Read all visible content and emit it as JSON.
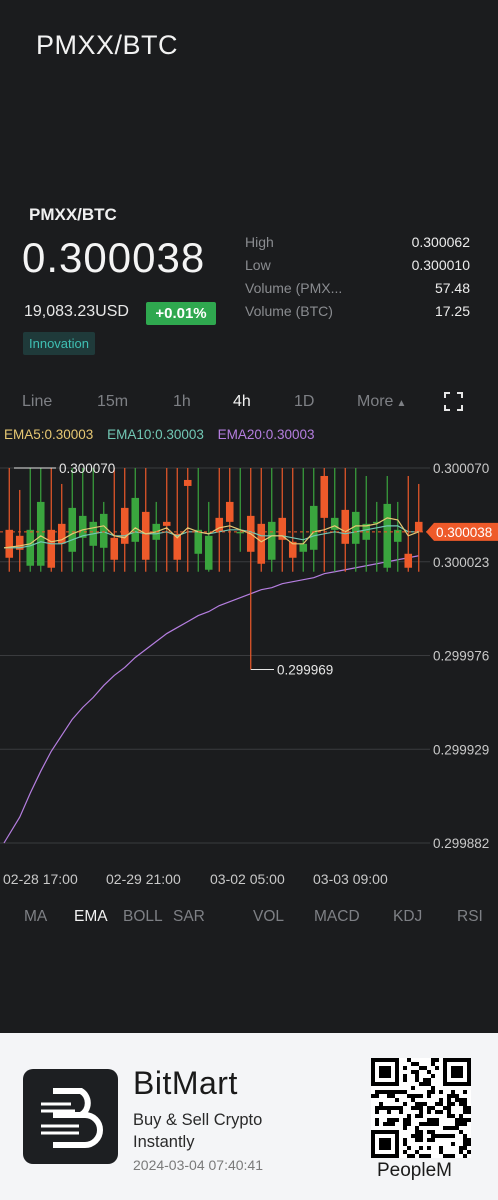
{
  "app": {
    "title": "PMXX/BTC"
  },
  "ticker": {
    "pair": "PMXX/BTC",
    "last_price": "0.300038",
    "usd_value": "19,083.23USD",
    "change": "+0.01%",
    "tag": "Innovation",
    "stats": [
      {
        "label": "High",
        "value": "0.300062"
      },
      {
        "label": "Low",
        "value": "0.300010"
      },
      {
        "label": "Volume (PMX...",
        "value": "57.48"
      },
      {
        "label": "Volume (BTC)",
        "value": "17.25"
      }
    ]
  },
  "timeframes": {
    "items": [
      "Line",
      "15m",
      "1h",
      "4h",
      "1D",
      "More"
    ],
    "active": "4h"
  },
  "ema_legend": {
    "ema5": "EMA5:0.30003",
    "ema10": "EMA10:0.30003",
    "ema20": "EMA20:0.30003"
  },
  "colors": {
    "up": "#3aa53e",
    "down": "#ee5a2a",
    "ema5": "#e7c873",
    "ema10": "#72c8b5",
    "ema20": "#b57ee0",
    "grid": "#3a3b3e",
    "badge_up": "#2fa84f"
  },
  "chart_data": {
    "type": "candlestick",
    "y_ticks": [
      "0.300070",
      "0.300023",
      "0.299976",
      "0.299929",
      "0.299882"
    ],
    "x_ticks": [
      "02-28 17:00",
      "02-29 21:00",
      "03-02 05:00",
      "03-03 09:00"
    ],
    "ylim": [
      0.299882,
      0.30007
    ],
    "last_price_label": "0.300038",
    "high_marker": "0.300070",
    "low_marker": "0.299969",
    "candles": [
      {
        "open": 0.300039,
        "close": 0.300025,
        "high": 0.30007,
        "low": 0.300018
      },
      {
        "open": 0.300036,
        "close": 0.300029,
        "high": 0.300059,
        "low": 0.300018
      },
      {
        "open": 0.300021,
        "close": 0.300039,
        "high": 0.30007,
        "low": 0.300018
      },
      {
        "open": 0.300021,
        "close": 0.300053,
        "high": 0.30007,
        "low": 0.300018
      },
      {
        "open": 0.300039,
        "close": 0.30002,
        "high": 0.30007,
        "low": 0.300018
      },
      {
        "open": 0.300042,
        "close": 0.300032,
        "high": 0.300062,
        "low": 0.300018
      },
      {
        "open": 0.300028,
        "close": 0.30005,
        "high": 0.30007,
        "low": 0.300018
      },
      {
        "open": 0.300035,
        "close": 0.300046,
        "high": 0.30007,
        "low": 0.300018
      },
      {
        "open": 0.300031,
        "close": 0.300043,
        "high": 0.30007,
        "low": 0.300018
      },
      {
        "open": 0.30003,
        "close": 0.300047,
        "high": 0.300053,
        "low": 0.300018
      },
      {
        "open": 0.300035,
        "close": 0.300024,
        "high": 0.30007,
        "low": 0.300018
      },
      {
        "open": 0.30005,
        "close": 0.300032,
        "high": 0.30007,
        "low": 0.300018
      },
      {
        "open": 0.300033,
        "close": 0.300055,
        "high": 0.30007,
        "low": 0.300018
      },
      {
        "open": 0.300048,
        "close": 0.300024,
        "high": 0.30007,
        "low": 0.300018
      },
      {
        "open": 0.300034,
        "close": 0.300042,
        "high": 0.300053,
        "low": 0.300018
      },
      {
        "open": 0.300043,
        "close": 0.300041,
        "high": 0.30007,
        "low": 0.300018
      },
      {
        "open": 0.300037,
        "close": 0.300024,
        "high": 0.30007,
        "low": 0.300018
      },
      {
        "open": 0.300064,
        "close": 0.300061,
        "high": 0.30007,
        "low": 0.300018
      },
      {
        "open": 0.300027,
        "close": 0.300039,
        "high": 0.30007,
        "low": 0.300018
      },
      {
        "open": 0.300019,
        "close": 0.300036,
        "high": 0.300053,
        "low": 0.300018
      },
      {
        "open": 0.300045,
        "close": 0.300038,
        "high": 0.30007,
        "low": 0.300018
      },
      {
        "open": 0.300053,
        "close": 0.300043,
        "high": 0.30007,
        "low": 0.300018
      },
      {
        "open": 0.300038,
        "close": 0.300038,
        "high": 0.30007,
        "low": 0.300028
      },
      {
        "open": 0.300046,
        "close": 0.300028,
        "high": 0.30007,
        "low": 0.299969
      },
      {
        "open": 0.300042,
        "close": 0.300022,
        "high": 0.30007,
        "low": 0.300018
      },
      {
        "open": 0.300024,
        "close": 0.300043,
        "high": 0.30007,
        "low": 0.300018
      },
      {
        "open": 0.300045,
        "close": 0.300034,
        "high": 0.30007,
        "low": 0.300018
      },
      {
        "open": 0.300033,
        "close": 0.300025,
        "high": 0.30007,
        "low": 0.300018
      },
      {
        "open": 0.300028,
        "close": 0.300032,
        "high": 0.30007,
        "low": 0.300018
      },
      {
        "open": 0.300029,
        "close": 0.300051,
        "high": 0.30007,
        "low": 0.300018
      },
      {
        "open": 0.300066,
        "close": 0.300045,
        "high": 0.30007,
        "low": 0.300018
      },
      {
        "open": 0.300039,
        "close": 0.300045,
        "high": 0.30007,
        "low": 0.300018
      },
      {
        "open": 0.300049,
        "close": 0.300032,
        "high": 0.30007,
        "low": 0.300018
      },
      {
        "open": 0.300032,
        "close": 0.300048,
        "high": 0.30007,
        "low": 0.300018
      },
      {
        "open": 0.300034,
        "close": 0.300042,
        "high": 0.300066,
        "low": 0.300018
      },
      {
        "open": 0.300043,
        "close": 0.300043,
        "high": 0.300053,
        "low": 0.300018
      },
      {
        "open": 0.30002,
        "close": 0.300052,
        "high": 0.300066,
        "low": 0.300018
      },
      {
        "open": 0.300033,
        "close": 0.300039,
        "high": 0.300053,
        "low": 0.300018
      },
      {
        "open": 0.300027,
        "close": 0.30002,
        "high": 0.300066,
        "low": 0.300018
      },
      {
        "open": 0.300043,
        "close": 0.300038,
        "high": 0.300062,
        "low": 0.300018
      }
    ],
    "ema5": [
      0.30003,
      0.300031,
      0.300032,
      0.300036,
      0.300033,
      0.300034,
      0.300037,
      0.300039,
      0.30004,
      0.300041,
      0.300036,
      0.300035,
      0.30004,
      0.300037,
      0.300038,
      0.30004,
      0.300035,
      0.30004,
      0.300038,
      0.300037,
      0.30004,
      0.300041,
      0.300039,
      0.300037,
      0.300033,
      0.300036,
      0.300036,
      0.300032,
      0.300032,
      0.300038,
      0.300039,
      0.300041,
      0.300038,
      0.300041,
      0.300041,
      0.300042,
      0.300045,
      0.300044,
      0.300036,
      0.300038
    ],
    "ema10": [
      0.30003,
      0.30003,
      0.300031,
      0.300033,
      0.300032,
      0.300032,
      0.300034,
      0.300036,
      0.300037,
      0.300038,
      0.300036,
      0.300036,
      0.300038,
      0.300037,
      0.300037,
      0.300038,
      0.300036,
      0.300038,
      0.300038,
      0.300037,
      0.300038,
      0.300039,
      0.300039,
      0.300038,
      0.300036,
      0.300036,
      0.300036,
      0.300035,
      0.300034,
      0.300036,
      0.300037,
      0.300038,
      0.300037,
      0.300038,
      0.300039,
      0.30004,
      0.300041,
      0.300041,
      0.300038,
      0.300038
    ],
    "ema20": [
      0.299882,
      0.299895,
      0.299907,
      0.299918,
      0.299928,
      0.299936,
      0.299944,
      0.29995,
      0.299955,
      0.299961,
      0.299966,
      0.29997,
      0.299975,
      0.299979,
      0.299983,
      0.299987,
      0.29999,
      0.299993,
      0.299996,
      0.299998,
      0.300001,
      0.300003,
      0.300005,
      0.300007,
      0.300009,
      0.30001,
      0.300012,
      0.300013,
      0.300014,
      0.300015,
      0.300017,
      0.300018,
      0.300019,
      0.30002,
      0.300021,
      0.300022,
      0.300023,
      0.300024,
      0.300025,
      0.300026
    ]
  },
  "indicators": {
    "items": [
      "MA",
      "EMA",
      "BOLL",
      "SAR",
      "VOL",
      "MACD",
      "KDJ",
      "RSI"
    ],
    "active": "EMA"
  },
  "footer": {
    "brand": "BitMart",
    "tagline": "Buy & Sell Crypto Instantly",
    "timestamp": "2024-03-04 07:40:41",
    "username": "PeopleM"
  }
}
